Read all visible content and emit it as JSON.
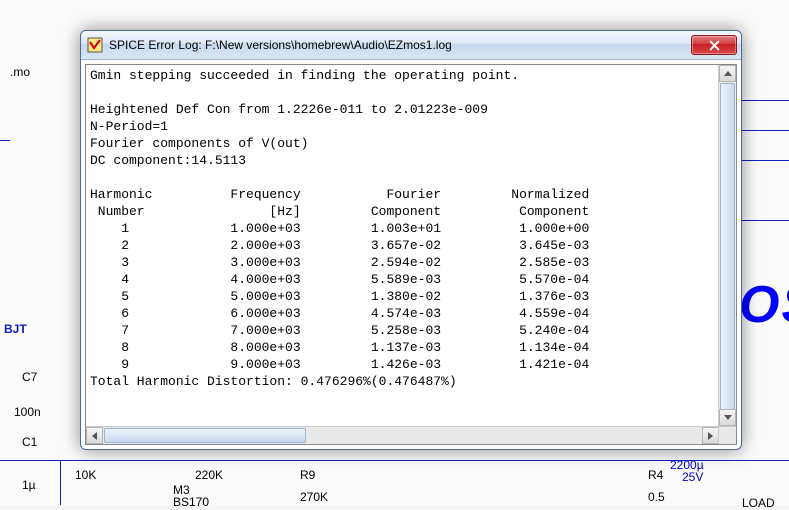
{
  "window": {
    "title": "SPICE Error Log: F:\\New versions\\homebrew\\Audio\\EZmos1.log"
  },
  "log": {
    "header_lines": [
      "Gmin stepping succeeded in finding the operating point.",
      "",
      "Heightened Def Con from 1.2226e-011 to 2.01223e-009",
      "N-Period=1",
      "Fourier components of V(out)",
      "DC component:14.5113",
      ""
    ],
    "table_header1": [
      "Harmonic",
      "Frequency",
      "Fourier",
      "Normalized"
    ],
    "table_header2": [
      "Number",
      "[Hz]",
      "Component",
      "Component"
    ],
    "rows": [
      {
        "n": "1",
        "freq": "1.000e+03",
        "four": "1.003e+01",
        "norm": "1.000e+00"
      },
      {
        "n": "2",
        "freq": "2.000e+03",
        "four": "3.657e-02",
        "norm": "3.645e-03"
      },
      {
        "n": "3",
        "freq": "3.000e+03",
        "four": "2.594e-02",
        "norm": "2.585e-03"
      },
      {
        "n": "4",
        "freq": "4.000e+03",
        "four": "5.589e-03",
        "norm": "5.570e-04"
      },
      {
        "n": "5",
        "freq": "5.000e+03",
        "four": "1.380e-02",
        "norm": "1.376e-03"
      },
      {
        "n": "6",
        "freq": "6.000e+03",
        "four": "4.574e-03",
        "norm": "4.559e-04"
      },
      {
        "n": "7",
        "freq": "7.000e+03",
        "four": "5.258e-03",
        "norm": "5.240e-04"
      },
      {
        "n": "8",
        "freq": "8.000e+03",
        "four": "1.137e-03",
        "norm": "1.134e-04"
      },
      {
        "n": "9",
        "freq": "9.000e+03",
        "four": "1.426e-03",
        "norm": "1.421e-04"
      }
    ],
    "thd_line": "Total Harmonic Distortion: 0.476296%(0.476487%)"
  },
  "schematic": {
    "bjt": "BJT",
    "big": "OS",
    "c7": "C7",
    "c7v": "100n",
    "c1": "C1",
    "c1v": "1µ",
    "r1": "10K",
    "r2": "220K",
    "r9": "R9",
    "r9v": "270K",
    "r4": "R4",
    "r4v": "0.5",
    "cap": "2200µ",
    "capv": "25V",
    "m3": "M3",
    "bs": "BS170",
    "load": "LOAD",
    "mo": ".mo"
  }
}
